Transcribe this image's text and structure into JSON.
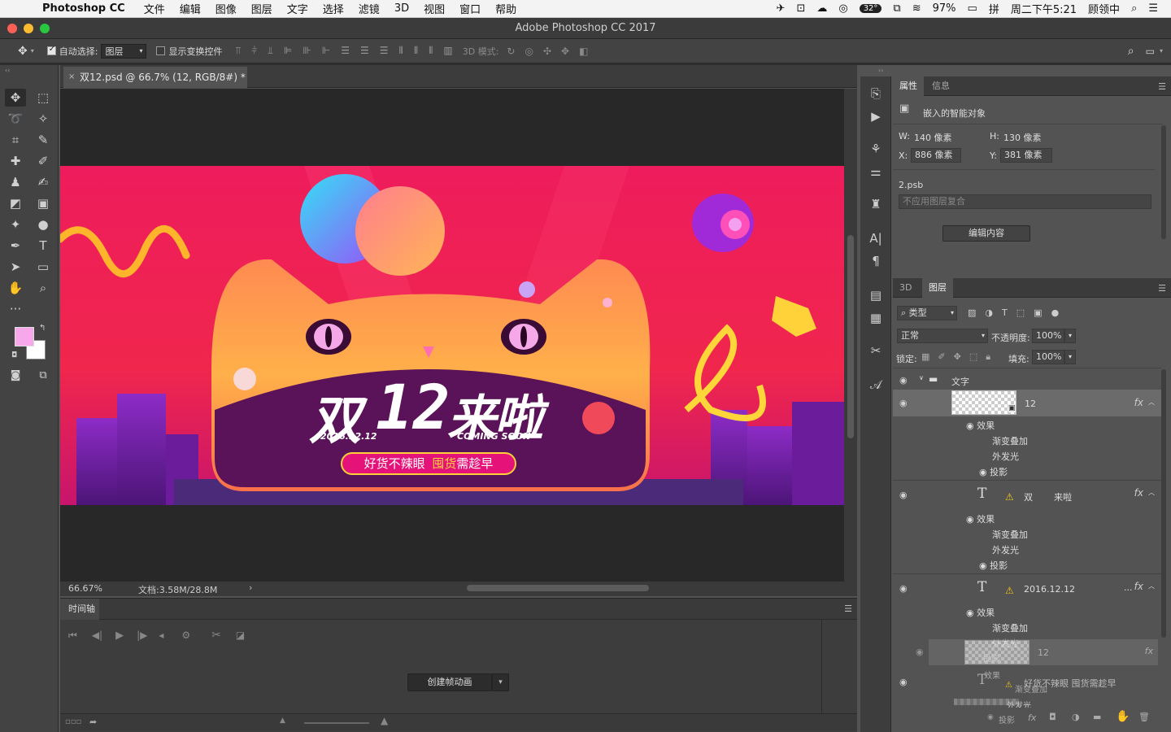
{
  "menubar": {
    "app_name": "Photoshop CC",
    "items": [
      "文件",
      "编辑",
      "图像",
      "图层",
      "文字",
      "选择",
      "滤镜",
      "3D",
      "视图",
      "窗口",
      "帮助"
    ],
    "battery": "97%",
    "clock": "周二下午5:21",
    "user": "顾领中",
    "temp_badge": "32°"
  },
  "window": {
    "title": "Adobe Photoshop CC 2017"
  },
  "options": {
    "auto_select_label": "自动选择:",
    "auto_select_value": "图层",
    "show_transform_label": "显示变换控件",
    "mode_3d_label": "3D 模式:"
  },
  "document": {
    "tab_title": "双12.psd @ 66.7% (12, RGB/8#) *",
    "zoom": "66.67%",
    "doc_info": "文档:3.58M/28.8M"
  },
  "artwork": {
    "headline_a": "双",
    "headline_num": "12",
    "headline_b": "来啦",
    "date": "2016.12.12",
    "coming": "COMING SOON",
    "slogan_a": "好货不辣眼",
    "slogan_b": "囤货",
    "slogan_c": "需趁早"
  },
  "timeline": {
    "tab": "时间轴",
    "create_button": "创建帧动画"
  },
  "properties": {
    "tabs": [
      "属性",
      "信息"
    ],
    "object_type": "嵌入的智能对象",
    "w_label": "W:",
    "w_value": "140 像素",
    "h_label": "H:",
    "h_value": "130 像素",
    "x_label": "X:",
    "x_value": "886 像素",
    "y_label": "Y:",
    "y_value": "381 像素",
    "file": "2.psb",
    "comp_placeholder": "不应用图层复合",
    "edit_button": "编辑内容"
  },
  "layers": {
    "tabs": [
      "3D",
      "图层"
    ],
    "filter_label": "类型",
    "blend_mode": "正常",
    "opacity_label": "不透明度:",
    "opacity_value": "100%",
    "lock_label": "锁定:",
    "fill_label": "填充:",
    "fill_value": "100%",
    "group_name": "文字",
    "layer1_name": "12",
    "layer2_name_a": "双",
    "layer2_name_b": "来啦",
    "layer3_name": "2016.12.12",
    "effects_label": "效果",
    "fx_gradient": "渐变叠加",
    "fx_glow": "外发光",
    "fx_shadow": "投影",
    "drag_layer_name": "12",
    "drag_effects": "效果",
    "drag_gradient": "渐变叠加",
    "drag_glow": "外发光",
    "drag_shadow": "投影",
    "layer4_name": "好货不辣眼 囤货需趁早",
    "fx_mark": "fx",
    "ellipsis": "..."
  }
}
